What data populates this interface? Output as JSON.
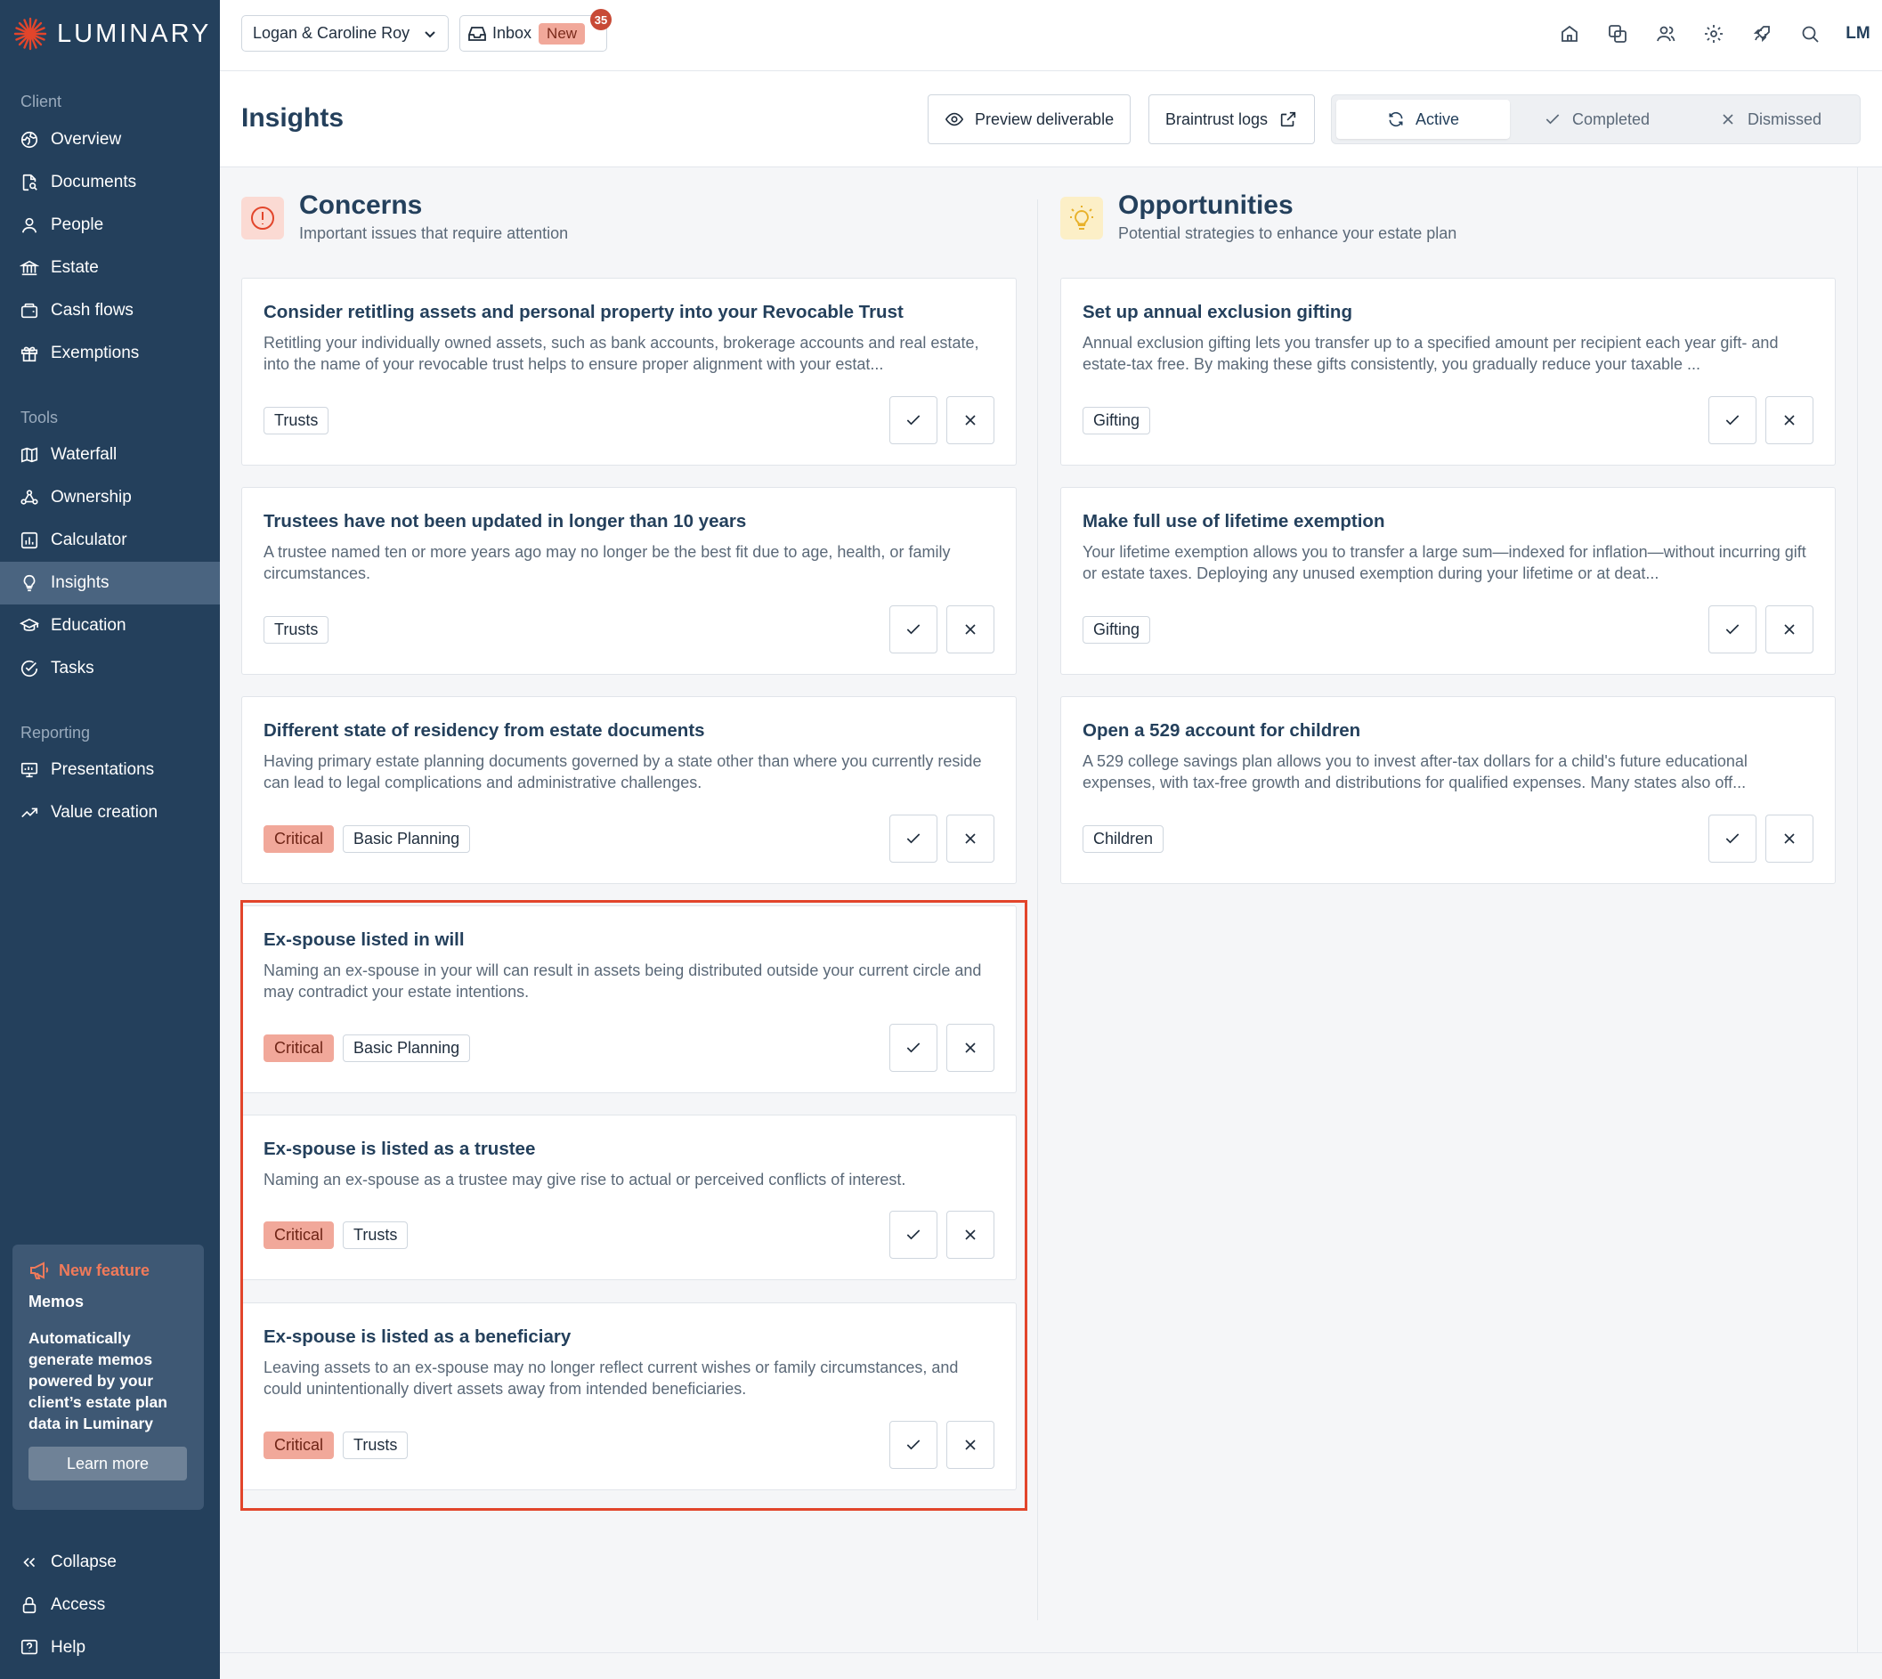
{
  "brand": {
    "name": "LUMINARY",
    "accent": "#e2452b",
    "sidebar_bg": "#24405c"
  },
  "sidebar": {
    "sections": [
      {
        "label": "Client",
        "items": [
          {
            "label": "Overview",
            "icon": "globe-icon"
          },
          {
            "label": "Documents",
            "icon": "document-search-icon"
          },
          {
            "label": "People",
            "icon": "person-icon"
          },
          {
            "label": "Estate",
            "icon": "bank-icon"
          },
          {
            "label": "Cash flows",
            "icon": "wallet-icon"
          },
          {
            "label": "Exemptions",
            "icon": "gift-icon"
          }
        ]
      },
      {
        "label": "Tools",
        "items": [
          {
            "label": "Waterfall",
            "icon": "map-icon"
          },
          {
            "label": "Ownership",
            "icon": "ownership-icon"
          },
          {
            "label": "Calculator",
            "icon": "bar-chart-icon"
          },
          {
            "label": "Insights",
            "icon": "lightbulb-icon",
            "active": true
          },
          {
            "label": "Education",
            "icon": "graduation-cap-icon"
          },
          {
            "label": "Tasks",
            "icon": "check-circle-icon"
          }
        ]
      },
      {
        "label": "Reporting",
        "items": [
          {
            "label": "Presentations",
            "icon": "presentation-icon"
          },
          {
            "label": "Value creation",
            "icon": "trend-up-icon"
          }
        ]
      }
    ],
    "feature": {
      "badge": "New feature",
      "title": "Memos",
      "description": "Automatically generate memos powered by your client’s estate plan data in Luminary",
      "button": "Learn more"
    },
    "footer": [
      {
        "label": "Collapse",
        "icon": "chevrons-left-icon"
      },
      {
        "label": "Access",
        "icon": "lock-icon"
      },
      {
        "label": "Help",
        "icon": "help-icon"
      }
    ]
  },
  "topbar": {
    "client": "Logan & Caroline Roy",
    "inbox_label": "Inbox",
    "inbox_new": "New",
    "inbox_count": "35",
    "icons": [
      "home-icon",
      "layers-icon",
      "users-icon",
      "gear-icon",
      "rocket-icon",
      "search-icon"
    ],
    "avatar": "LM"
  },
  "header": {
    "title": "Insights",
    "preview_button": "Preview deliverable",
    "logs_button": "Braintrust logs",
    "tabs": [
      {
        "label": "Active",
        "icon": "refresh-icon",
        "active": true
      },
      {
        "label": "Completed",
        "icon": "check-icon"
      },
      {
        "label": "Dismissed",
        "icon": "close-icon"
      }
    ]
  },
  "concerns": {
    "title": "Concerns",
    "subtitle": "Important issues that require attention",
    "cards": [
      {
        "title": "Consider retitling assets and personal property into your Revocable Trust",
        "description": "Retitling your individually owned assets, such as bank accounts, brokerage accounts and real estate, into the name of your revocable trust helps to ensure proper alignment with your estat...",
        "tags": [
          "Trusts"
        ],
        "critical": false
      },
      {
        "title": "Trustees have not been updated in longer than 10 years",
        "description": "A trustee named ten or more years ago may no longer be the best fit due to age, health, or family circumstances.",
        "tags": [
          "Trusts"
        ],
        "critical": false
      },
      {
        "title": "Different state of residency from estate documents",
        "description": "Having primary estate planning documents governed by a state other than where you currently reside can lead to legal complications and administrative challenges.",
        "tags": [
          "Critical",
          "Basic Planning"
        ],
        "critical": true
      },
      {
        "title": "Ex-spouse listed in will",
        "description": "Naming an ex-spouse in your will can result in assets being distributed outside your current circle and may contradict your estate intentions.",
        "tags": [
          "Critical",
          "Basic Planning"
        ],
        "critical": true
      },
      {
        "title": "Ex-spouse is listed as a trustee",
        "description": "Naming an ex-spouse as a trustee may give rise to actual or perceived conflicts of interest.",
        "tags": [
          "Critical",
          "Trusts"
        ],
        "critical": true
      },
      {
        "title": "Ex-spouse is listed as a beneficiary",
        "description": "Leaving assets to an ex-spouse may no longer reflect current wishes or family circumstances, and could unintentionally divert assets away from intended beneficiaries.",
        "tags": [
          "Critical",
          "Trusts"
        ],
        "critical": true
      }
    ]
  },
  "opportunities": {
    "title": "Opportunities",
    "subtitle": "Potential strategies to enhance your estate plan",
    "cards": [
      {
        "title": "Set up annual exclusion gifting",
        "description": "Annual exclusion gifting lets you transfer up to a specified amount per recipient each year gift- and estate-tax free. By making these gifts consistently, you gradually reduce your taxable ...",
        "tags": [
          "Gifting"
        ],
        "critical": false
      },
      {
        "title": "Make full use of lifetime exemption",
        "description": "Your lifetime exemption allows you to transfer a large sum—indexed for inflation—without incurring gift or estate taxes. Deploying any unused exemption during your lifetime or at deat...",
        "tags": [
          "Gifting"
        ],
        "critical": false
      },
      {
        "title": "Open a 529 account for children",
        "description": "A 529 college savings plan allows you to invest after-tax dollars for a child's future educational expenses, with tax-free growth and distributions for qualified expenses. Many states also off...",
        "tags": [
          "Children"
        ],
        "critical": false
      }
    ]
  }
}
